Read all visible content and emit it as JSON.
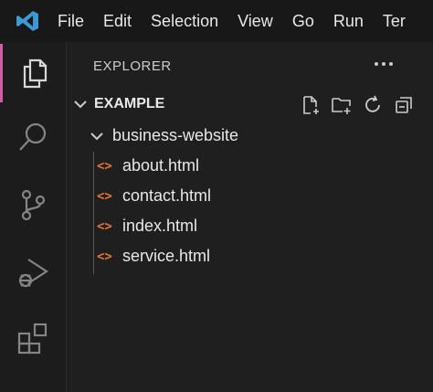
{
  "menu": {
    "items": [
      "File",
      "Edit",
      "Selection",
      "View",
      "Go",
      "Run",
      "Ter"
    ]
  },
  "explorer": {
    "header": "EXPLORER",
    "section_title": "EXAMPLE",
    "folder": "business-website",
    "files": [
      "about.html",
      "contact.html",
      "index.html",
      "service.html"
    ],
    "file_icon_glyph": "<>"
  },
  "colors": {
    "accent_active": "#cf5fa0",
    "file_icon": "#e37933",
    "logo": "#3c99d4"
  },
  "icons": {
    "activity": [
      "explorer-icon",
      "search-icon",
      "source-control-icon",
      "run-debug-icon",
      "extensions-icon"
    ],
    "section_actions": [
      "new-file-icon",
      "new-folder-icon",
      "refresh-icon",
      "collapse-all-icon"
    ]
  }
}
